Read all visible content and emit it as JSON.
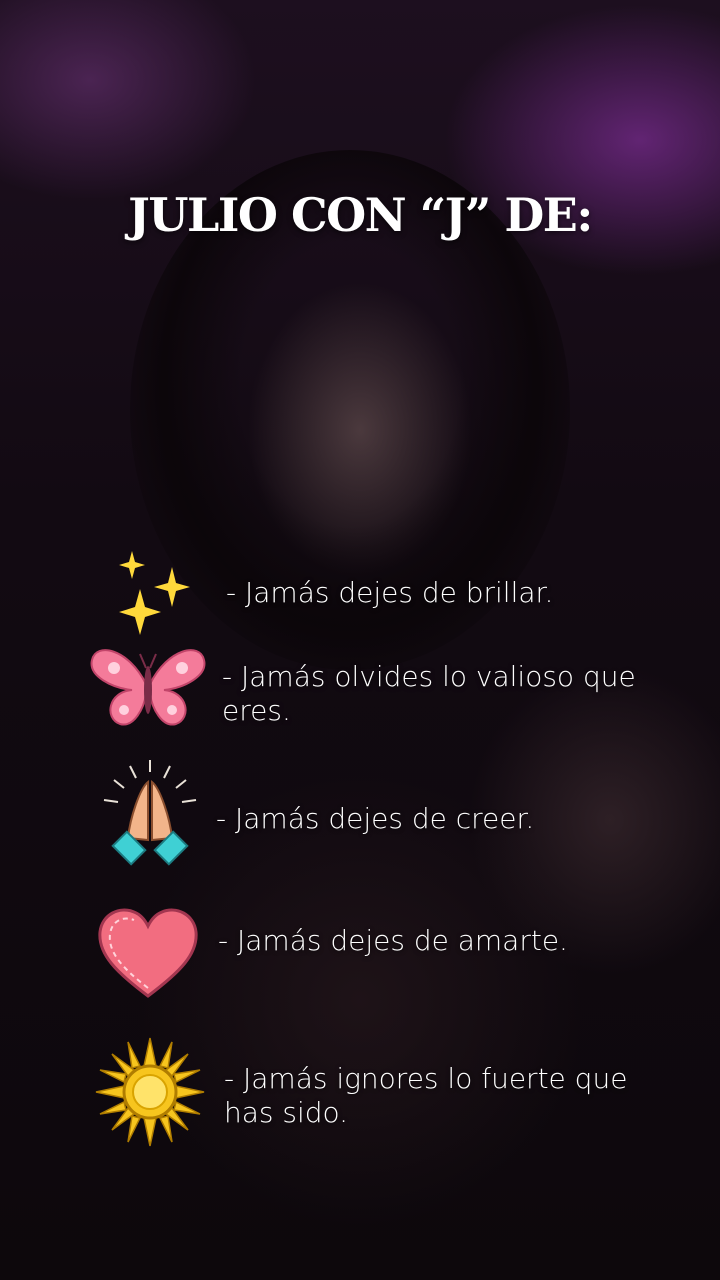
{
  "title": "JULIO CON “J” DE:",
  "items": [
    {
      "icon": "sparkles-icon",
      "text": "- Jamás dejes de brillar."
    },
    {
      "icon": "butterfly-icon",
      "text": "- Jamás olvides lo valioso que eres."
    },
    {
      "icon": "praying-hands-icon",
      "text": "- Jamás dejes de creer."
    },
    {
      "icon": "heart-icon",
      "text": "- Jamás dejes de amarte."
    },
    {
      "icon": "sun-icon",
      "text": "- Jamás ignores lo fuerte que has sido."
    }
  ],
  "colors": {
    "sparkle": "#FFD93B",
    "butterfly": "#F47B9A",
    "hands": "#F2B48A",
    "cuffs": "#3FD0D4",
    "heart": "#F26D80",
    "sun": "#F7C51E"
  }
}
